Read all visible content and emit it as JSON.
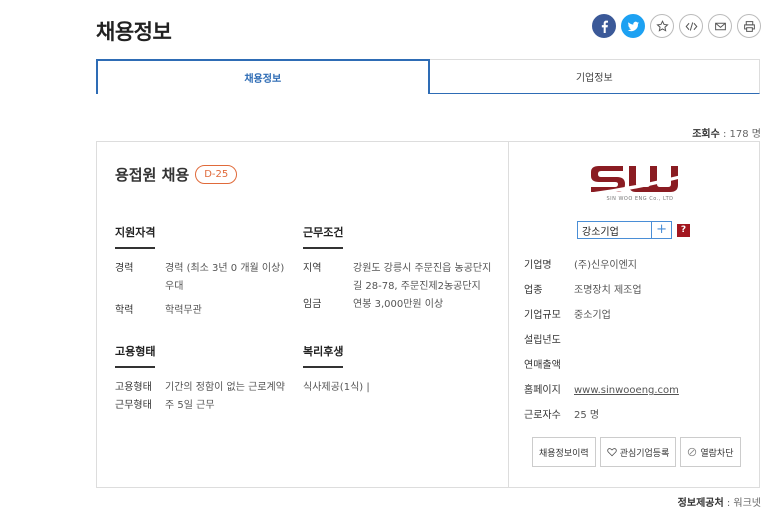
{
  "page": {
    "title": "채용정보"
  },
  "share": {
    "icons": [
      "facebook-icon",
      "twitter-icon",
      "star-icon",
      "embed-icon",
      "mail-icon",
      "print-icon"
    ]
  },
  "tabs": [
    {
      "label": "채용정보",
      "active": true
    },
    {
      "label": "기업정보",
      "active": false
    }
  ],
  "stats": {
    "views_label": "조회수",
    "views_value": " : 178 명"
  },
  "job": {
    "title": "용접원 채용",
    "dday": "D-25",
    "qualification": {
      "heading": "지원자격",
      "rows": [
        {
          "k": "경력",
          "v": "경력 (최소 3년 0 개월 이상) 우대"
        },
        {
          "k": "학력",
          "v": "학력무관"
        }
      ]
    },
    "conditions": {
      "heading": "근무조건",
      "rows": [
        {
          "k": "지역",
          "v": "강원도 강릉시 주문진읍 농공단지길 28-78, 주문진제2농공단지"
        },
        {
          "k": "임금",
          "v": "연봉 3,000만원 이상"
        }
      ]
    },
    "employment": {
      "heading": "고용형태",
      "rows": [
        {
          "k": "고용형태",
          "v": "기간의 정함이 없는 근로계약"
        },
        {
          "k": "근무형태",
          "v": "주 5일 근무"
        }
      ]
    },
    "welfare": {
      "heading": "복리후생",
      "rows": [
        {
          "v": "식사제공(1식) |"
        }
      ]
    }
  },
  "company": {
    "logo_text": "SW",
    "logo_sub": "SIN WOO ENG Co., LTD",
    "type_label": "강소기업",
    "type_plus": "+",
    "help": "?",
    "rows": [
      {
        "k": "기업명",
        "v": "(주)신우이엔지"
      },
      {
        "k": "업종",
        "v": "조명장치 제조업"
      },
      {
        "k": "기업규모",
        "v": "중소기업"
      },
      {
        "k": "설립년도",
        "v": ""
      },
      {
        "k": "연매출액",
        "v": ""
      },
      {
        "k": "홈페이지",
        "v": "www.sinwooeng.com"
      },
      {
        "k": "근로자수",
        "v": "25 명"
      }
    ],
    "buttons": {
      "history": "채용정보이력",
      "favorite": "관심기업등록",
      "block": "열람차단"
    },
    "colors": {
      "logo": "#8a1c22",
      "accent": "#2e6cb5"
    }
  },
  "footer": {
    "provider_label": "정보제공처",
    "provider_value": " : 워크넷"
  }
}
